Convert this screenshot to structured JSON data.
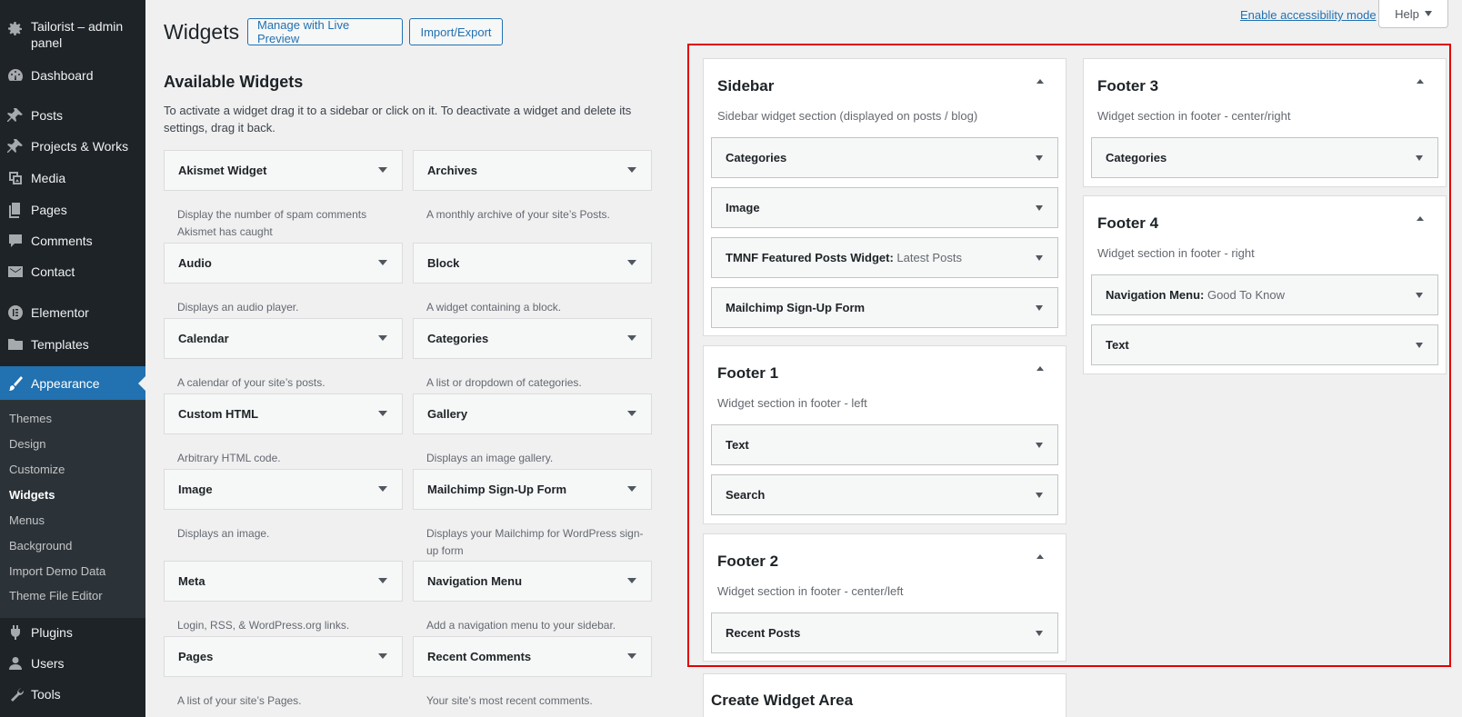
{
  "menu": {
    "site_name": "Tailorist – admin panel",
    "items": [
      {
        "label": "Dashboard",
        "icon": "dashboard-icon"
      },
      {
        "label": "Posts",
        "icon": "pin-icon"
      },
      {
        "label": "Projects & Works",
        "icon": "pin-icon"
      },
      {
        "label": "Media",
        "icon": "media-icon"
      },
      {
        "label": "Pages",
        "icon": "pages-icon"
      },
      {
        "label": "Comments",
        "icon": "comments-icon"
      },
      {
        "label": "Contact",
        "icon": "mail-icon"
      },
      {
        "label": "Elementor",
        "icon": "elementor-icon"
      },
      {
        "label": "Templates",
        "icon": "folder-icon"
      },
      {
        "label": "Appearance",
        "icon": "brush-icon"
      },
      {
        "label": "Plugins",
        "icon": "plugin-icon"
      },
      {
        "label": "Users",
        "icon": "users-icon"
      },
      {
        "label": "Tools",
        "icon": "wrench-icon"
      }
    ],
    "submenu": [
      "Themes",
      "Design",
      "Customize",
      "Widgets",
      "Menus",
      "Background",
      "Import Demo Data",
      "Theme File Editor"
    ]
  },
  "topbar": {
    "accessibility": "Enable accessibility mode",
    "help": "Help"
  },
  "header": {
    "title": "Widgets",
    "live_preview": "Manage with Live Preview",
    "import_export": "Import/Export"
  },
  "available": {
    "title": "Available Widgets",
    "description": "To activate a widget drag it to a sidebar or click on it. To deactivate a widget and delete its settings, drag it back.",
    "widgets": [
      {
        "name": "Akismet Widget",
        "desc": "Display the number of spam comments Akismet has caught"
      },
      {
        "name": "Archives",
        "desc": "A monthly archive of your site’s Posts."
      },
      {
        "name": "Audio",
        "desc": "Displays an audio player."
      },
      {
        "name": "Block",
        "desc": "A widget containing a block."
      },
      {
        "name": "Calendar",
        "desc": "A calendar of your site’s posts."
      },
      {
        "name": "Categories",
        "desc": "A list or dropdown of categories."
      },
      {
        "name": "Custom HTML",
        "desc": "Arbitrary HTML code."
      },
      {
        "name": "Gallery",
        "desc": "Displays an image gallery."
      },
      {
        "name": "Image",
        "desc": "Displays an image."
      },
      {
        "name": "Mailchimp Sign-Up Form",
        "desc": "Displays your Mailchimp for WordPress sign-up form"
      },
      {
        "name": "Meta",
        "desc": "Login, RSS, & WordPress.org links."
      },
      {
        "name": "Navigation Menu",
        "desc": "Add a navigation menu to your sidebar."
      },
      {
        "name": "Pages",
        "desc": "A list of your site’s Pages."
      },
      {
        "name": "Recent Comments",
        "desc": "Your site’s most recent comments."
      }
    ]
  },
  "sidebars": {
    "sidebar": {
      "title": "Sidebar",
      "desc": "Sidebar widget section (displayed on posts / blog)",
      "widgets": [
        {
          "name": "Categories",
          "title": ""
        },
        {
          "name": "Image",
          "title": ""
        },
        {
          "name": "TMNF Featured Posts Widget:",
          "title": "Latest Posts"
        },
        {
          "name": "Mailchimp Sign-Up Form",
          "title": ""
        }
      ]
    },
    "footer1": {
      "title": "Footer 1",
      "desc": "Widget section in footer - left",
      "widgets": [
        {
          "name": "Text",
          "title": ""
        },
        {
          "name": "Search",
          "title": ""
        }
      ]
    },
    "footer2": {
      "title": "Footer 2",
      "desc": "Widget section in footer - center/left",
      "widgets": [
        {
          "name": "Recent Posts",
          "title": ""
        }
      ]
    },
    "footer3": {
      "title": "Footer 3",
      "desc": "Widget section in footer - center/right",
      "widgets": [
        {
          "name": "Categories",
          "title": ""
        }
      ]
    },
    "footer4": {
      "title": "Footer 4",
      "desc": "Widget section in footer - right",
      "widgets": [
        {
          "name": "Navigation Menu:",
          "title": "Good To Know"
        },
        {
          "name": "Text",
          "title": ""
        }
      ]
    }
  },
  "create_area": {
    "title": "Create Widget Area"
  }
}
